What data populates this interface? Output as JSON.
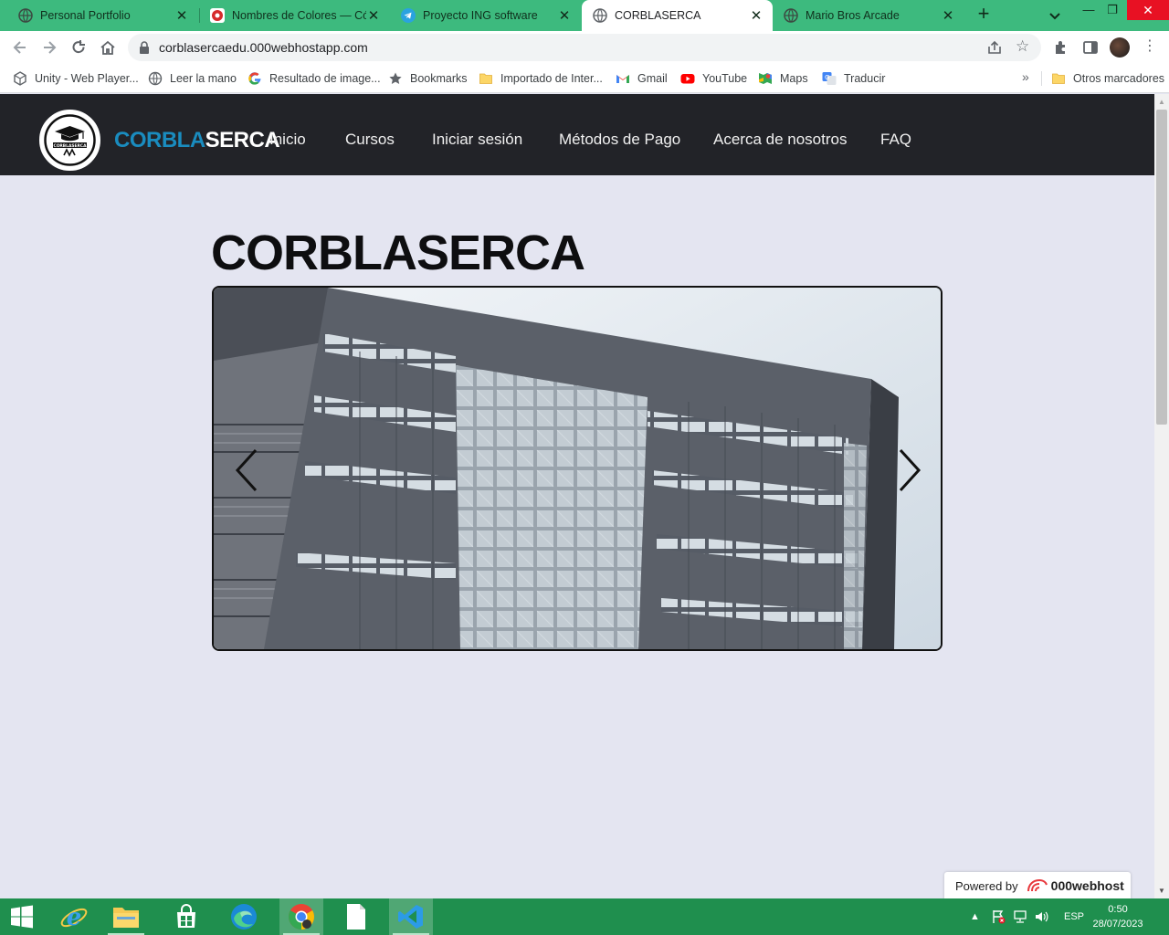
{
  "browser": {
    "tabs": [
      {
        "title": "Personal Portfolio",
        "icon": "globe-icon",
        "active": false
      },
      {
        "title": "Nombres de Colores — Cód",
        "icon": "red-circle-icon",
        "active": false
      },
      {
        "title": "Proyecto ING software",
        "icon": "telegram-icon",
        "active": false
      },
      {
        "title": "CORBLASERCA",
        "icon": "globe-icon",
        "active": true
      },
      {
        "title": "Mario Bros Arcade",
        "icon": "globe-icon",
        "active": false
      }
    ],
    "new_tab": "+",
    "url": "corblasercaedu.000webhostapp.com",
    "bookmarks": [
      {
        "label": "Unity - Web Player...",
        "icon": "unity-icon"
      },
      {
        "label": "Leer la mano",
        "icon": "globe-icon"
      },
      {
        "label": "Resultado de image...",
        "icon": "google-icon"
      },
      {
        "label": "Bookmarks",
        "icon": "star-icon"
      },
      {
        "label": "Importado de Inter...",
        "icon": "folder-icon"
      },
      {
        "label": "Gmail",
        "icon": "gmail-icon"
      },
      {
        "label": "YouTube",
        "icon": "youtube-icon"
      },
      {
        "label": "Maps",
        "icon": "maps-icon"
      },
      {
        "label": "Traducir",
        "icon": "translate-icon"
      }
    ],
    "bookmarks_overflow": "»",
    "other_bookmarks": "Otros marcadores"
  },
  "site": {
    "brand_part1": "CORBLA",
    "brand_part2": "SERCA",
    "logo_text": "CORBLASERCA",
    "nav": [
      "Inicio",
      "Cursos",
      "Iniciar sesión",
      "Métodos de Pago",
      "Acerca de nosotros",
      "FAQ"
    ],
    "page_title": "CORBLASERCA",
    "carousel": {
      "prev": "previous",
      "next": "next"
    },
    "powered_by": "Powered by",
    "host_brand": "000webhost"
  },
  "taskbar": {
    "apps": [
      "windows-start",
      "internet-explorer",
      "file-explorer",
      "microsoft-store",
      "edge",
      "chrome",
      "notepad",
      "vscode"
    ],
    "language": "ESP",
    "time": "0:50",
    "date": "28/07/2023"
  },
  "colors": {
    "tab_strip": "#3dba7e",
    "site_header": "#222328",
    "brand_accent": "#1a8cbf",
    "page_bg": "#e4e5f1",
    "taskbar": "#1f8f4e"
  }
}
